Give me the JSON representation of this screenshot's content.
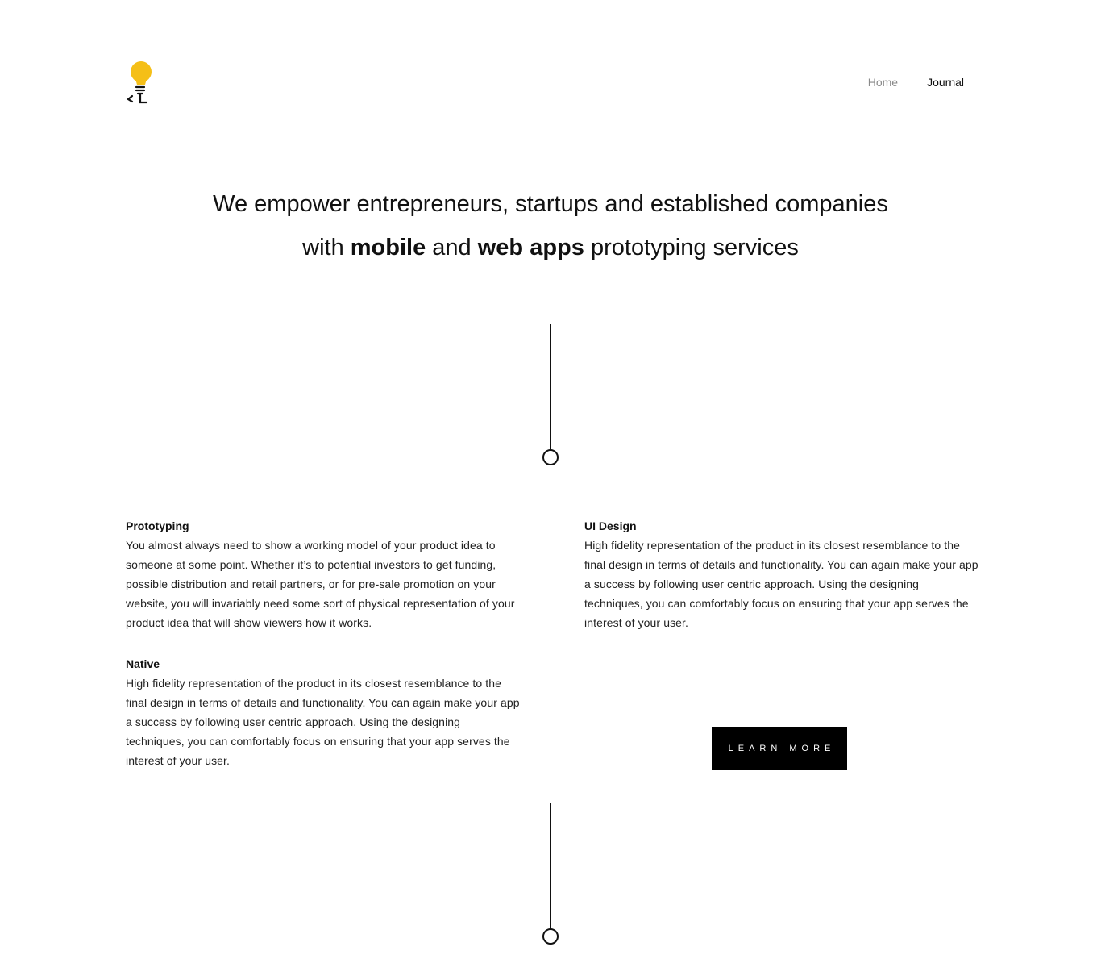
{
  "header": {
    "logo_icon": "lightbulb-icon",
    "logo_color": "#f5bf17",
    "nav": [
      {
        "label": "Home"
      },
      {
        "label": "Journal"
      }
    ]
  },
  "hero": {
    "line1": "We empower entrepreneurs, startups and established companies",
    "line2_prefix": "with",
    "line2_bold1": "mobile",
    "line2_mid": "and",
    "line2_bold2": "web apps",
    "line2_suffix": "prototyping services"
  },
  "services": [
    {
      "title": "Prototyping",
      "body": "You almost always need to show a working model of your product idea to someone at some point. Whether it’s to potential investors to get funding, possible distribution and retail partners, or for pre-sale promotion on your website, you will invariably need some sort of physical representation of your product idea that will show viewers how it works."
    },
    {
      "title": "UI Design",
      "body": "High fidelity representation of the product in its closest resemblance to the final design in terms of details and functionality. You can again make your app a success by following user centric approach. Using the designing techniques, you can comfortably focus on ensuring that your app serves the interest of your user."
    },
    {
      "title": "Native",
      "body": "High fidelity representation of the product in its closest resemblance to the final design in terms of details and functionality. You can again make your app a success by following user centric approach. Using the designing techniques, you can comfortably focus on ensuring that your app serves the interest of your user."
    }
  ],
  "cta": {
    "label": "LEARN MORE",
    "background": "#000000",
    "text_color": "#ffffff"
  }
}
